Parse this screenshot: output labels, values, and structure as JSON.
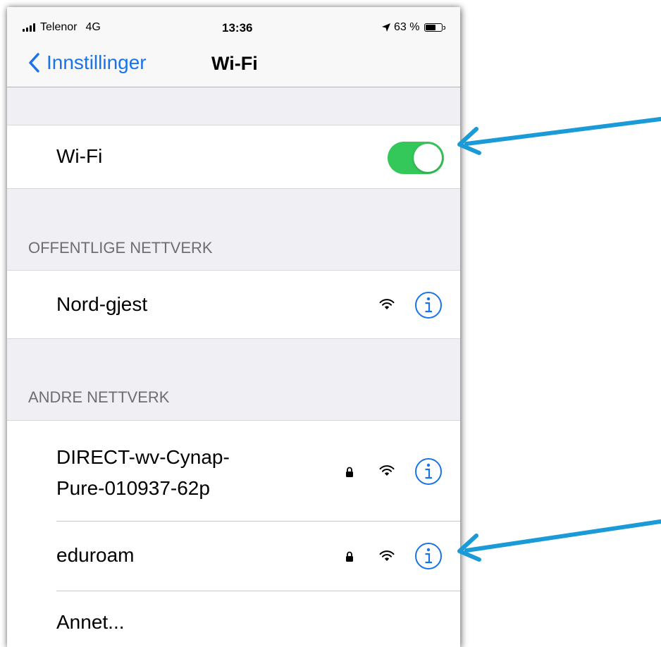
{
  "status_bar": {
    "carrier": "Telenor",
    "network": "4G",
    "time": "13:36",
    "battery": "63 %"
  },
  "nav": {
    "back_label": "Innstillinger",
    "title": "Wi-Fi"
  },
  "wifi_toggle": {
    "label": "Wi-Fi",
    "on": true,
    "color": "#34c759"
  },
  "public_section": {
    "header": "OFFENTLIGE NETTVERK",
    "networks": [
      {
        "name": "Nord-gjest",
        "locked": false
      }
    ]
  },
  "other_section": {
    "header": "ANDRE NETTVERK",
    "networks": [
      {
        "name_line1": "DIRECT-wv-Cynap-",
        "name_line2": "Pure-010937-62p",
        "locked": true
      },
      {
        "name": "eduroam",
        "locked": true
      }
    ],
    "other_label": "Annet..."
  },
  "colors": {
    "accent": "#1a73e8",
    "annotation_arrow": "#1a9ad6"
  }
}
